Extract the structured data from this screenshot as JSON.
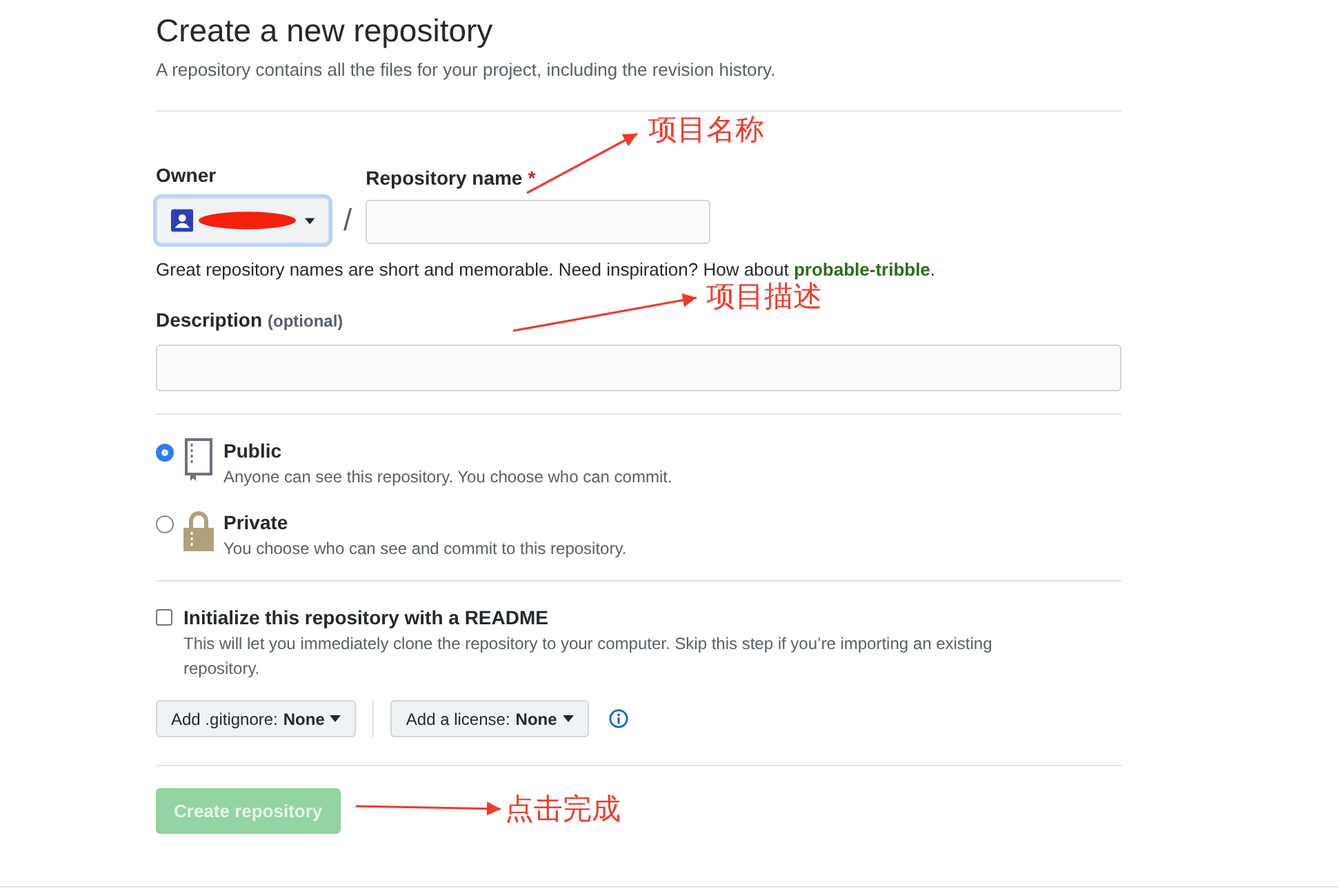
{
  "header": {
    "title": "Create a new repository",
    "subtitle": "A repository contains all the files for your project, including the revision history."
  },
  "owner": {
    "label": "Owner",
    "redacted": true
  },
  "separator": "/",
  "repo_name": {
    "label": "Repository name",
    "required_mark": "*"
  },
  "name_hint": {
    "text": "Great repository names are short and memorable. Need inspiration? How about ",
    "suggestion": "probable-tribble",
    "end": "."
  },
  "description": {
    "label": "Description",
    "optional": "(optional)"
  },
  "visibility": [
    {
      "kind": "book",
      "label": "Public",
      "text": "Anyone can see this repository. You choose who can commit.",
      "selected": true
    },
    {
      "kind": "lock",
      "label": "Private",
      "text": "You choose who can see and commit to this repository.",
      "selected": false
    }
  ],
  "readme": {
    "label": "Initialize this repository with a README",
    "text": "This will let you immediately clone the repository to your computer. Skip this step if you’re importing an existing repository.",
    "checked": false
  },
  "dropdowns": [
    {
      "label": "Add .gitignore:",
      "value": "None"
    },
    {
      "label": "Add a license:",
      "value": "None"
    }
  ],
  "submit": {
    "label": "Create repository",
    "disabled": true
  },
  "annotations": [
    {
      "text": "项目名称"
    },
    {
      "text": "项目描述"
    },
    {
      "text": "点击完成"
    }
  ]
}
